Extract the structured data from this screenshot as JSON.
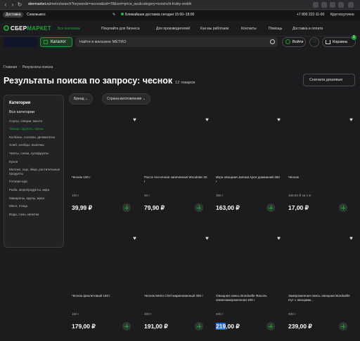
{
  "browser": {
    "url_domain": "sbermarket.ru",
    "url_path": "/metro/search?keywords=чеснок&sid=78&sort=price_asc&category=ovoshchi-frukty-orekhi"
  },
  "info_bar": {
    "delivery_tab": "Доставка",
    "pickup_tab": "Самовывоз",
    "nearest_delivery": "Ближайшая доставка сегодня 15:00–18:00",
    "phone": "+7 800 222-11-00",
    "hours": "Круглосуточно"
  },
  "header": {
    "logo_part1": "СБЕР",
    "logo_part2": "МАРКЕТ",
    "all_stores": "Все магазины",
    "links": [
      "Покупайте для бизнеса",
      "Для производителей",
      "Как мы работаем",
      "Контакты",
      "Помощь",
      "Доставка и оплата"
    ]
  },
  "search": {
    "catalog_label": "Каталог",
    "placeholder": "Найти в магазине METRO",
    "login_label": "Войти",
    "cart_label": "Корзина",
    "cart_count": "1"
  },
  "breadcrumb": {
    "home": "Главная",
    "current": "Результаты поиска"
  },
  "title": {
    "text": "Результаты поиска по запросу: чеснок",
    "count": "12 товаров"
  },
  "sort": {
    "label": "Сначала дешевые"
  },
  "filters": {
    "brand": "Бренд",
    "country": "Страна изготовления"
  },
  "sidebar": {
    "title": "Категория",
    "all_label": "Все категории",
    "categories": [
      "Соусы, специи, масло",
      "Овощи, фрукты, орехи",
      "Колбасы, сосиски, деликатесы",
      "Хлеб, хлебцы, выпечка",
      "Чипсы, снеки, сухофрукты",
      "Кухня",
      "Молоко, сыр, яйца, растительные продукты",
      "Готовая еда",
      "Рыба, морепродукты, икра",
      "Макароны, крупы, мука",
      "Мясо, птица",
      "Вода, соки, напитки"
    ],
    "active_index": 1
  },
  "products": [
    {
      "name": "Чеснок 100 г",
      "weight": "100 г",
      "price": "39,99 ₽"
    },
    {
      "name": "Паста чесночная запеченная Woodstar 40 г",
      "weight": "40 г",
      "price": "79,90 ₽"
    },
    {
      "name": "Икра овощная Jamaat Ajvar домашний 360 г",
      "weight": "360 г",
      "price": "163,00 ₽"
    },
    {
      "name": "Чеснок",
      "weight": "166,84 ₽ за 1 кг",
      "price": "17,00 ₽"
    },
    {
      "name": "Чеснок фиолетовый 150 г",
      "weight": "150 г",
      "price": "179,00 ₽"
    },
    {
      "name": "Чеснок Metro Chef маринованный 400 г",
      "weight": "400 г",
      "price": "191,00 ₽"
    },
    {
      "name": "Овощная смесь Bonduelle Фасоль свежезамороженная 400 г",
      "weight": "400 г",
      "price_hl": "219",
      "price_rest": ",00 ₽"
    },
    {
      "name": "Замороженная смесь овощная Bonduelle Нут с овощами…",
      "weight": "400 г",
      "price": "239,00 ₽"
    }
  ]
}
